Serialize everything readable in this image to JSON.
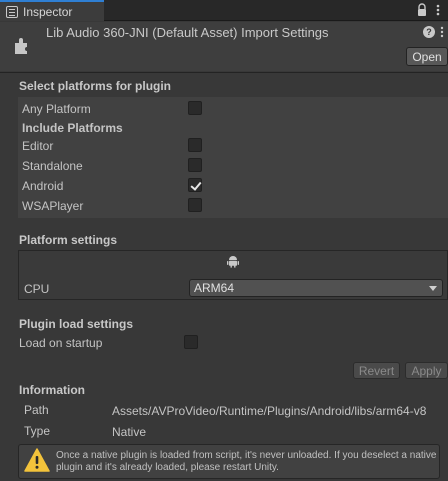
{
  "tab": {
    "label": "Inspector"
  },
  "header": {
    "title": "Lib Audio 360-JNI (Default Asset) Import Settings",
    "help_glyph": "?",
    "open_label": "Open"
  },
  "platforms": {
    "heading": "Select platforms for plugin",
    "any_platform": {
      "label": "Any Platform",
      "checked": false
    },
    "include_heading": "Include Platforms",
    "items": [
      {
        "label": "Editor",
        "checked": false
      },
      {
        "label": "Standalone",
        "checked": false
      },
      {
        "label": "Android",
        "checked": true
      },
      {
        "label": "WSAPlayer",
        "checked": false
      }
    ]
  },
  "platform_settings": {
    "heading": "Platform settings",
    "active_tab_icon": "android-icon",
    "cpu_label": "CPU",
    "cpu_value": "ARM64"
  },
  "load_settings": {
    "heading": "Plugin load settings",
    "load_on_startup_label": "Load on startup",
    "load_on_startup": false
  },
  "actions": {
    "revert": "Revert",
    "apply": "Apply"
  },
  "information": {
    "heading": "Information",
    "path_label": "Path",
    "path_value": "Assets/AVProVideo/Runtime/Plugins/Android/libs/arm64-v8",
    "type_label": "Type",
    "type_value": "Native"
  },
  "warning": {
    "icon": "warning-icon",
    "text": "Once a native plugin is loaded from script, it's never unloaded. If you deselect a native plugin and it's already loaded, please restart Unity."
  },
  "colors": {
    "accent": "#2f7fd3",
    "warning": "#f3c33b"
  }
}
